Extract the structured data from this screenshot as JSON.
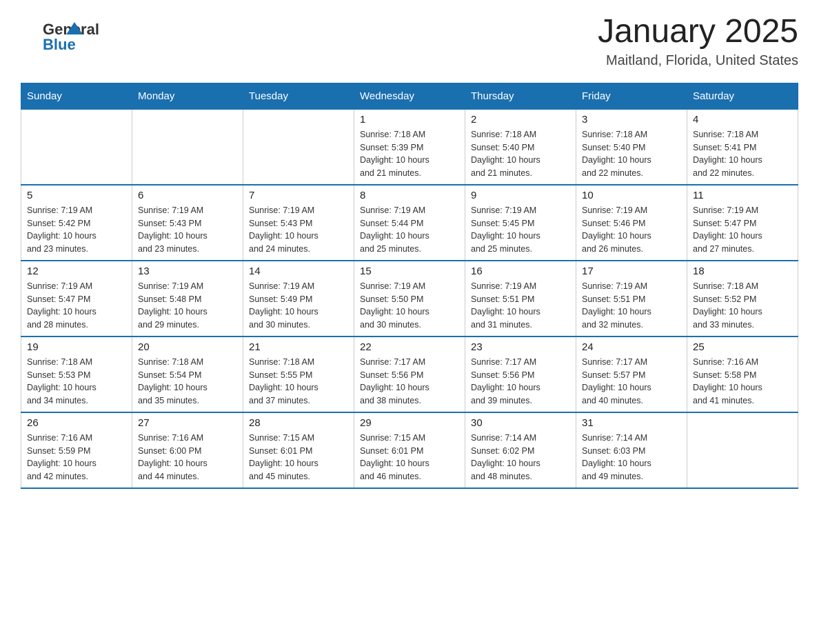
{
  "header": {
    "logo_general": "General",
    "logo_blue": "Blue",
    "title": "January 2025",
    "location": "Maitland, Florida, United States"
  },
  "days_of_week": [
    "Sunday",
    "Monday",
    "Tuesday",
    "Wednesday",
    "Thursday",
    "Friday",
    "Saturday"
  ],
  "weeks": [
    [
      {
        "day": "",
        "info": ""
      },
      {
        "day": "",
        "info": ""
      },
      {
        "day": "",
        "info": ""
      },
      {
        "day": "1",
        "info": "Sunrise: 7:18 AM\nSunset: 5:39 PM\nDaylight: 10 hours\nand 21 minutes."
      },
      {
        "day": "2",
        "info": "Sunrise: 7:18 AM\nSunset: 5:40 PM\nDaylight: 10 hours\nand 21 minutes."
      },
      {
        "day": "3",
        "info": "Sunrise: 7:18 AM\nSunset: 5:40 PM\nDaylight: 10 hours\nand 22 minutes."
      },
      {
        "day": "4",
        "info": "Sunrise: 7:18 AM\nSunset: 5:41 PM\nDaylight: 10 hours\nand 22 minutes."
      }
    ],
    [
      {
        "day": "5",
        "info": "Sunrise: 7:19 AM\nSunset: 5:42 PM\nDaylight: 10 hours\nand 23 minutes."
      },
      {
        "day": "6",
        "info": "Sunrise: 7:19 AM\nSunset: 5:43 PM\nDaylight: 10 hours\nand 23 minutes."
      },
      {
        "day": "7",
        "info": "Sunrise: 7:19 AM\nSunset: 5:43 PM\nDaylight: 10 hours\nand 24 minutes."
      },
      {
        "day": "8",
        "info": "Sunrise: 7:19 AM\nSunset: 5:44 PM\nDaylight: 10 hours\nand 25 minutes."
      },
      {
        "day": "9",
        "info": "Sunrise: 7:19 AM\nSunset: 5:45 PM\nDaylight: 10 hours\nand 25 minutes."
      },
      {
        "day": "10",
        "info": "Sunrise: 7:19 AM\nSunset: 5:46 PM\nDaylight: 10 hours\nand 26 minutes."
      },
      {
        "day": "11",
        "info": "Sunrise: 7:19 AM\nSunset: 5:47 PM\nDaylight: 10 hours\nand 27 minutes."
      }
    ],
    [
      {
        "day": "12",
        "info": "Sunrise: 7:19 AM\nSunset: 5:47 PM\nDaylight: 10 hours\nand 28 minutes."
      },
      {
        "day": "13",
        "info": "Sunrise: 7:19 AM\nSunset: 5:48 PM\nDaylight: 10 hours\nand 29 minutes."
      },
      {
        "day": "14",
        "info": "Sunrise: 7:19 AM\nSunset: 5:49 PM\nDaylight: 10 hours\nand 30 minutes."
      },
      {
        "day": "15",
        "info": "Sunrise: 7:19 AM\nSunset: 5:50 PM\nDaylight: 10 hours\nand 30 minutes."
      },
      {
        "day": "16",
        "info": "Sunrise: 7:19 AM\nSunset: 5:51 PM\nDaylight: 10 hours\nand 31 minutes."
      },
      {
        "day": "17",
        "info": "Sunrise: 7:19 AM\nSunset: 5:51 PM\nDaylight: 10 hours\nand 32 minutes."
      },
      {
        "day": "18",
        "info": "Sunrise: 7:18 AM\nSunset: 5:52 PM\nDaylight: 10 hours\nand 33 minutes."
      }
    ],
    [
      {
        "day": "19",
        "info": "Sunrise: 7:18 AM\nSunset: 5:53 PM\nDaylight: 10 hours\nand 34 minutes."
      },
      {
        "day": "20",
        "info": "Sunrise: 7:18 AM\nSunset: 5:54 PM\nDaylight: 10 hours\nand 35 minutes."
      },
      {
        "day": "21",
        "info": "Sunrise: 7:18 AM\nSunset: 5:55 PM\nDaylight: 10 hours\nand 37 minutes."
      },
      {
        "day": "22",
        "info": "Sunrise: 7:17 AM\nSunset: 5:56 PM\nDaylight: 10 hours\nand 38 minutes."
      },
      {
        "day": "23",
        "info": "Sunrise: 7:17 AM\nSunset: 5:56 PM\nDaylight: 10 hours\nand 39 minutes."
      },
      {
        "day": "24",
        "info": "Sunrise: 7:17 AM\nSunset: 5:57 PM\nDaylight: 10 hours\nand 40 minutes."
      },
      {
        "day": "25",
        "info": "Sunrise: 7:16 AM\nSunset: 5:58 PM\nDaylight: 10 hours\nand 41 minutes."
      }
    ],
    [
      {
        "day": "26",
        "info": "Sunrise: 7:16 AM\nSunset: 5:59 PM\nDaylight: 10 hours\nand 42 minutes."
      },
      {
        "day": "27",
        "info": "Sunrise: 7:16 AM\nSunset: 6:00 PM\nDaylight: 10 hours\nand 44 minutes."
      },
      {
        "day": "28",
        "info": "Sunrise: 7:15 AM\nSunset: 6:01 PM\nDaylight: 10 hours\nand 45 minutes."
      },
      {
        "day": "29",
        "info": "Sunrise: 7:15 AM\nSunset: 6:01 PM\nDaylight: 10 hours\nand 46 minutes."
      },
      {
        "day": "30",
        "info": "Sunrise: 7:14 AM\nSunset: 6:02 PM\nDaylight: 10 hours\nand 48 minutes."
      },
      {
        "day": "31",
        "info": "Sunrise: 7:14 AM\nSunset: 6:03 PM\nDaylight: 10 hours\nand 49 minutes."
      },
      {
        "day": "",
        "info": ""
      }
    ]
  ]
}
